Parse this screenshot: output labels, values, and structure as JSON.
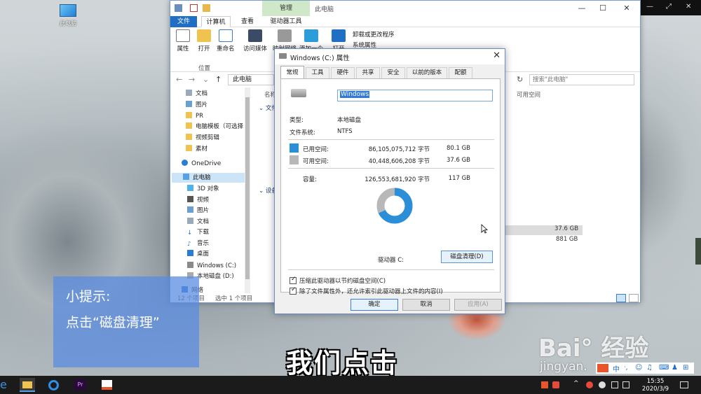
{
  "desktop": {
    "icon_label": "此电脑"
  },
  "explorer": {
    "title_context_tab": "管理",
    "title": "此电脑",
    "ribbon_tabs": [
      "文件",
      "计算机",
      "查看",
      "驱动器工具"
    ],
    "ribbon_buttons": [
      "属性",
      "打开",
      "重命名",
      "访问媒体",
      "映射网络驱",
      "添加一个",
      "打开",
      "卸载或更改程序",
      "系统属性"
    ],
    "group_label": "位置",
    "address": "此电脑",
    "search_placeholder": "搜索\"此电脑\"",
    "nav_items": [
      "文档",
      "图片",
      "PR",
      "电脑模板（可选择",
      "视频剪辑",
      "素材",
      "OneDrive",
      "此电脑",
      "3D 对象",
      "视频",
      "图片",
      "文档",
      "下载",
      "音乐",
      "桌面",
      "Windows (C:)",
      "本地磁盘 (D:)",
      "网络"
    ],
    "column_name": "名称",
    "column_available": "可用空间",
    "content_groups": [
      "文件",
      "设备"
    ],
    "drive_c_free": "37.6 GB",
    "drive_d_free": "881 GB",
    "status_items": "12 个项目",
    "status_selected": "选中 1 个项目"
  },
  "dialog": {
    "title": "Windows (C:) 属性",
    "tabs": [
      "常规",
      "工具",
      "硬件",
      "共享",
      "安全",
      "以前的版本",
      "配额"
    ],
    "volume_name": "Windows",
    "type_label": "类型:",
    "type_value": "本地磁盘",
    "fs_label": "文件系统:",
    "fs_value": "NTFS",
    "used_label": "已用空间:",
    "used_bytes": "86,105,075,712 字节",
    "used_gb": "80.1 GB",
    "free_label": "可用空间:",
    "free_bytes": "40,448,606,208 字节",
    "free_gb": "37.6 GB",
    "capacity_label": "容量:",
    "capacity_bytes": "126,553,681,920 字节",
    "capacity_gb": "117 GB",
    "used_fraction": 0.68,
    "drive_label": "驱动器 C:",
    "cleanup_button": "磁盘清理(D)",
    "compress_option": "压缩此驱动器以节约磁盘空间(C)",
    "index_option": "除了文件属性外，还允许索引此驱动器上文件的内容(I)",
    "ok": "确定",
    "cancel": "取消",
    "apply": "应用(A)",
    "colors": {
      "used": "#2a8fd8",
      "free": "#b8b8b8"
    }
  },
  "hint": {
    "title": "小提示:",
    "body": "点击“磁盘清理”"
  },
  "subtitle": "我们点击",
  "watermark": {
    "logo": "Bai° 经验",
    "url": "jingyan."
  },
  "taskbar": {
    "time": "15:35",
    "date": "2020/3/9"
  }
}
